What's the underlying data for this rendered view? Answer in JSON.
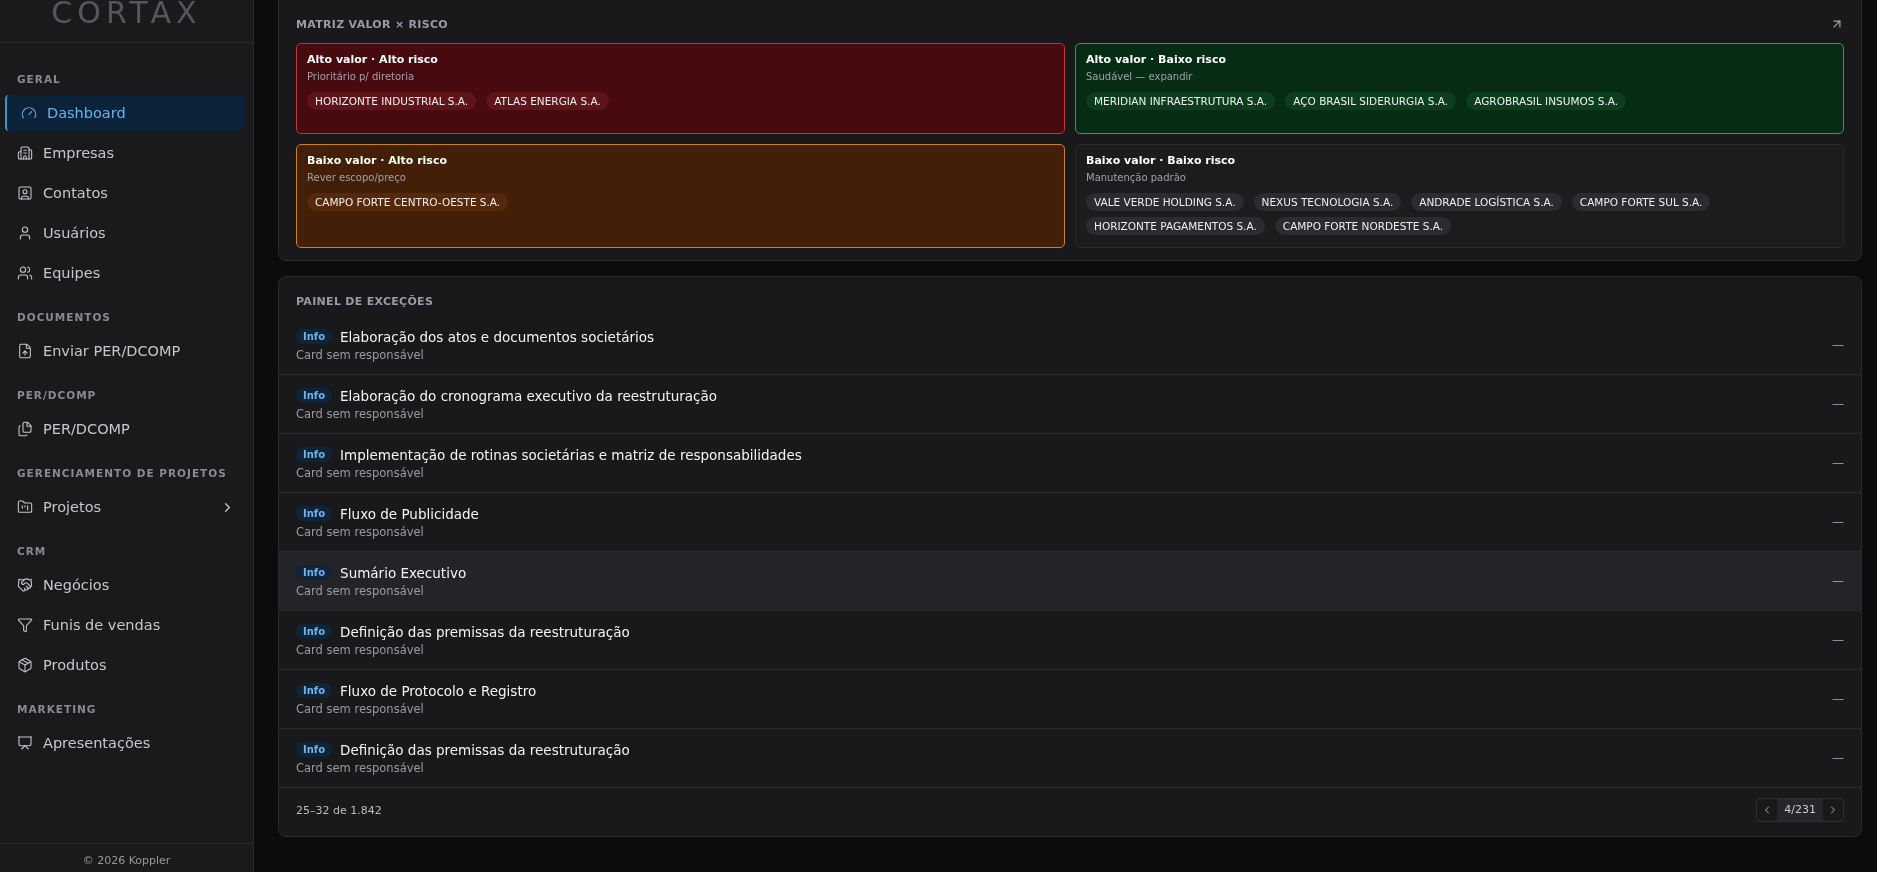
{
  "sidebar": {
    "logo": "CORTAX",
    "sections": [
      {
        "title": "GERAL",
        "items": [
          {
            "label": "Dashboard",
            "selected": true
          },
          {
            "label": "Empresas",
            "selected": false
          },
          {
            "label": "Contatos",
            "selected": false
          },
          {
            "label": "Usuários",
            "selected": false
          },
          {
            "label": "Equipes",
            "selected": false
          }
        ]
      },
      {
        "title": "DOCUMENTOS",
        "items": [
          {
            "label": "Enviar PER/DCOMP",
            "selected": false
          }
        ]
      },
      {
        "title": "PER/DCOMP",
        "items": [
          {
            "label": "PER/DCOMP",
            "selected": false
          }
        ]
      },
      {
        "title": "GERENCIAMENTO DE PROJETOS",
        "items": [
          {
            "label": "Projetos",
            "selected": false,
            "expandable": true
          }
        ]
      },
      {
        "title": "CRM",
        "items": [
          {
            "label": "Negócios",
            "selected": false
          },
          {
            "label": "Funis de vendas",
            "selected": false
          },
          {
            "label": "Produtos",
            "selected": false
          }
        ]
      },
      {
        "title": "MARKETING",
        "items": [
          {
            "label": "Apresentações",
            "selected": false
          }
        ]
      }
    ],
    "footer": "© 2026 Koppler"
  },
  "matrix": {
    "title": "MATRIZ VALOR × RISCO",
    "quadrants": [
      {
        "title": "Alto valor · Alto risco",
        "subtitle": "Prioritário p/ diretoria",
        "kind": "danger",
        "companies": [
          "HORIZONTE INDUSTRIAL S.A.",
          "ATLAS ENERGIA S.A."
        ]
      },
      {
        "title": "Alto valor · Baixo risco",
        "subtitle": "Saudável — expandir",
        "kind": "success",
        "companies": [
          "MERIDIAN INFRAESTRUTURA S.A.",
          "AÇO BRASIL SIDERURGIA S.A.",
          "AGROBRASIL INSUMOS S.A."
        ]
      },
      {
        "title": "Baixo valor · Alto risco",
        "subtitle": "Rever escopo/preço",
        "kind": "warning",
        "companies": [
          "CAMPO FORTE CENTRO-OESTE S.A."
        ]
      },
      {
        "title": "Baixo valor · Baixo risco",
        "subtitle": "Manutenção padrão",
        "kind": "neutral",
        "companies": [
          "VALE VERDE HOLDING S.A.",
          "NEXUS TECNOLOGIA S.A.",
          "ANDRADE LOGÍSTICA S.A.",
          "CAMPO FORTE SUL S.A.",
          "HORIZONTE PAGAMENTOS S.A.",
          "CAMPO FORTE NORDESTE S.A."
        ]
      }
    ]
  },
  "exceptions": {
    "title": "PAINEL DE EXCEÇÕES",
    "rows": [
      {
        "badge": "Info",
        "title": "Elaboração dos atos e documentos societários",
        "subtitle": "Card sem responsável",
        "value": "—",
        "selected": false
      },
      {
        "badge": "Info",
        "title": "Elaboração do cronograma executivo da reestruturação",
        "subtitle": "Card sem responsável",
        "value": "—",
        "selected": false
      },
      {
        "badge": "Info",
        "title": "Implementação de rotinas societárias e matriz de responsabilidades",
        "subtitle": "Card sem responsável",
        "value": "—",
        "selected": false
      },
      {
        "badge": "Info",
        "title": "Fluxo de Publicidade",
        "subtitle": "Card sem responsável",
        "value": "—",
        "selected": false
      },
      {
        "badge": "Info",
        "title": "Sumário Executivo",
        "subtitle": "Card sem responsável",
        "value": "—",
        "selected": true
      },
      {
        "badge": "Info",
        "title": "Definição das premissas da reestruturação",
        "subtitle": "Card sem responsável",
        "value": "—",
        "selected": false
      },
      {
        "badge": "Info",
        "title": "Fluxo de Protocolo e Registro",
        "subtitle": "Card sem responsável",
        "value": "—",
        "selected": false
      },
      {
        "badge": "Info",
        "title": "Definição das premissas da reestruturação",
        "subtitle": "Card sem responsável",
        "value": "—",
        "selected": false
      }
    ],
    "range": "25–32 de 1.842",
    "page": "4/231"
  }
}
